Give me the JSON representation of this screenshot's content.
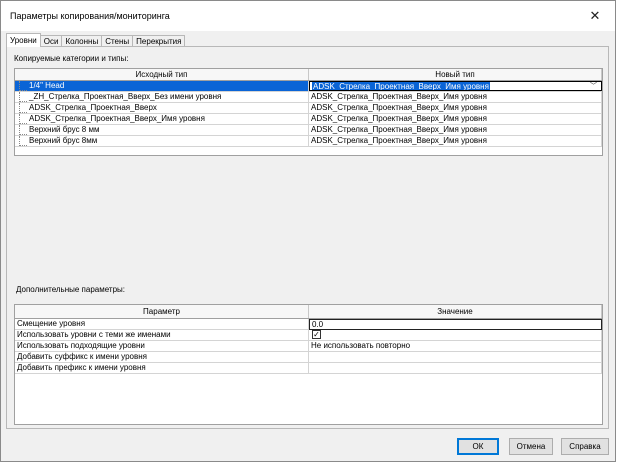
{
  "window": {
    "title": "Параметры копирования/мониторинга"
  },
  "tabs": [
    {
      "label": "Уровни",
      "active": true
    },
    {
      "label": "Оси"
    },
    {
      "label": "Колонны"
    },
    {
      "label": "Стены"
    },
    {
      "label": "Перекрытия"
    }
  ],
  "categories": {
    "label": "Копируемые категории и типы:",
    "columns": [
      "Исходный тип",
      "Новый тип"
    ],
    "rows": [
      {
        "source": "1/4\" Head",
        "target": "ADSK_Стрелка_Проектная_Вверх_Имя уровня"
      },
      {
        "source": "_ZH_Стрелка_Проектная_Вверх_Без имени уровня",
        "target": "ADSK_Стрелка_Проектная_Вверх_Имя уровня"
      },
      {
        "source": "ADSK_Стрелка_Проектная_Вверх",
        "target": "ADSK_Стрелка_Проектная_Вверх_Имя уровня"
      },
      {
        "source": "ADSK_Стрелка_Проектная_Вверх_Имя уровня",
        "target": "ADSK_Стрелка_Проектная_Вверх_Имя уровня"
      },
      {
        "source": "Верхний брус 8 мм",
        "target": "ADSK_Стрелка_Проектная_Вверх_Имя уровня"
      },
      {
        "source": "Верхний брус 8мм",
        "target": "ADSK_Стрелка_Проектная_Вверх_Имя уровня"
      }
    ]
  },
  "params": {
    "label": "Дополнительные параметры:",
    "columns": [
      "Параметр",
      "Значение"
    ],
    "rows": [
      {
        "name": "Смещение уровня",
        "value": "0.0"
      },
      {
        "name": "Использовать уровни с теми же именами",
        "value": "",
        "checked": true
      },
      {
        "name": "Использовать подходящие уровни",
        "value": "Не использовать повторно"
      },
      {
        "name": "Добавить суффикс к имени уровня",
        "value": ""
      },
      {
        "name": "Добавить префикс к имени уровня",
        "value": ""
      }
    ]
  },
  "buttons": {
    "ok": "ОК",
    "cancel": "Отмена",
    "help": "Справка"
  },
  "colors": {
    "selection": "#0a64d6",
    "underline": "#e01b1b",
    "default_border": "#0078d7"
  }
}
